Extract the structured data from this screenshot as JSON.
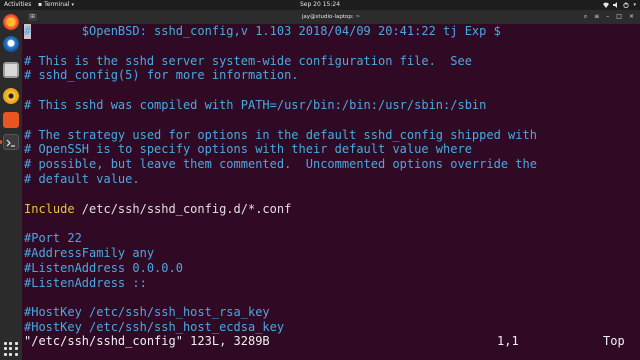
{
  "topbar": {
    "activities": "Activities",
    "app_name": "Terminal",
    "clock": "Sep 20  15:24"
  },
  "terminal": {
    "title": "jay@studio-laptop: ~",
    "lines": [
      {
        "text": "#\t$OpenBSD: sshd_config,v 1.103 2018/04/09 20:41:22 tj Exp $",
        "kind": "comment"
      },
      {
        "text": "",
        "kind": "blank"
      },
      {
        "text": "# This is the sshd server system-wide configuration file.  See",
        "kind": "comment"
      },
      {
        "text": "# sshd_config(5) for more information.",
        "kind": "comment"
      },
      {
        "text": "",
        "kind": "blank"
      },
      {
        "text": "# This sshd was compiled with PATH=/usr/bin:/bin:/usr/sbin:/sbin",
        "kind": "comment"
      },
      {
        "text": "",
        "kind": "blank"
      },
      {
        "text": "# The strategy used for options in the default sshd_config shipped with",
        "kind": "comment"
      },
      {
        "text": "# OpenSSH is to specify options with their default value where",
        "kind": "comment"
      },
      {
        "text": "# possible, but leave them commented.  Uncommented options override the",
        "kind": "comment"
      },
      {
        "text": "# default value.",
        "kind": "comment"
      },
      {
        "text": "",
        "kind": "blank"
      },
      {
        "text": "Include",
        "rest": " /etc/ssh/sshd_config.d/*.conf",
        "kind": "include"
      },
      {
        "text": "",
        "kind": "blank"
      },
      {
        "text": "#Port 22",
        "kind": "comment"
      },
      {
        "text": "#AddressFamily any",
        "kind": "comment"
      },
      {
        "text": "#ListenAddress 0.0.0.0",
        "kind": "comment"
      },
      {
        "text": "#ListenAddress ::",
        "kind": "comment"
      },
      {
        "text": "",
        "kind": "blank"
      },
      {
        "text": "#HostKey /etc/ssh/ssh_host_rsa_key",
        "kind": "comment"
      },
      {
        "text": "#HostKey /etc/ssh/ssh_host_ecdsa_key",
        "kind": "comment"
      }
    ],
    "status_file": "\"/etc/ssh/sshd_config\" 123L, 3289B",
    "status_position": "1,1",
    "status_scroll": "Top"
  }
}
